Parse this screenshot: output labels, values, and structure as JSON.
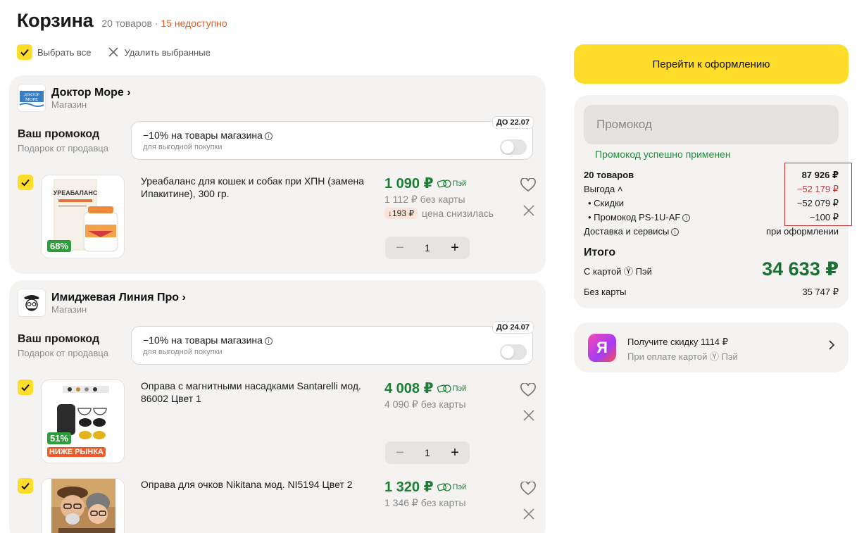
{
  "header": {
    "title": "Корзина",
    "count": "20 товаров",
    "separator": " · ",
    "unavailable": "15 недоступно"
  },
  "controls": {
    "select_all": "Выбрать все",
    "delete_selected": "Удалить выбранные"
  },
  "shops": [
    {
      "name": "Доктор Море",
      "type": "Магазин",
      "logo_text": "ДОКТОР МОРЕ",
      "promo_label": "Ваш промокод",
      "promo_sub": "Подарок от продавца",
      "promo_title": "−10% на товары магазина",
      "promo_desc": "для выгодной покупки",
      "promo_date": "ДО 22.07"
    },
    {
      "name": "Имиджевая Линия Про",
      "type": "Магазин",
      "promo_label": "Ваш промокод",
      "promo_sub": "Подарок от продавца",
      "promo_title": "−10% на товары магазина",
      "promo_desc": "для выгодной покупки",
      "promo_date": "ДО 24.07"
    }
  ],
  "items": [
    {
      "name": "Уреабаланс для кошек и собак при ХПН (замена Ипакитине), 300 гр.",
      "price": "1 090 ₽",
      "pay_label": "Пэй",
      "no_card_price": "1 112 ₽ без карты",
      "drop_amount": "↓193 ₽",
      "drop_text": "цена снизилась",
      "badge_pct": "68%",
      "product_label": "УРЕАБАЛАНС",
      "qty": "1"
    },
    {
      "name": "Оправа с магнитными насадками Santarelli мод. 86002 Цвет 1",
      "price": "4 008 ₽",
      "pay_label": "Пэй",
      "no_card_price": "4 090 ₽ без карты",
      "badge_pct": "51%",
      "badge_low": "НИЖЕ РЫНКА",
      "qty": "1"
    },
    {
      "name": "Оправа для очков Nikitana мод. NI5194 Цвет 2",
      "price": "1 320 ₽",
      "pay_label": "Пэй",
      "no_card_price": "1 346 ₽ без карты"
    }
  ],
  "qty_controls": {
    "minus": "−",
    "plus": "+"
  },
  "checkout": {
    "label": "Перейти к оформлению"
  },
  "summary": {
    "promo_placeholder": "Промокод",
    "promo_success": "Промокод успешно применен",
    "goods_label": "20 товаров",
    "goods_value": "87 926 ₽",
    "benefit_label": "Выгода",
    "benefit_value": "−52 179 ₽",
    "discounts_label": "• Скидки",
    "discounts_value": "−52 079 ₽",
    "promo_line_label": "• Промокод PS-1U-AF",
    "promo_line_value": "−100 ₽",
    "delivery_label": "Доставка и сервисы",
    "delivery_value": "при оформлении",
    "total_label": "Итого",
    "with_card_label": "С картой Ⓨ Пэй",
    "total_value": "34 633 ₽",
    "without_card_label": "Без карты",
    "without_card_value": "35 747 ₽"
  },
  "offer": {
    "logo_letter": "Я",
    "title": "Получите скидку 1114 ₽",
    "subtitle": "При оплате картой Ⓨ Пэй"
  },
  "colors": {
    "accent_yellow": "#fedc2a",
    "price_green": "#1d7f35",
    "warning_orange": "#e85a1c",
    "discount_red": "#c43a3a"
  }
}
